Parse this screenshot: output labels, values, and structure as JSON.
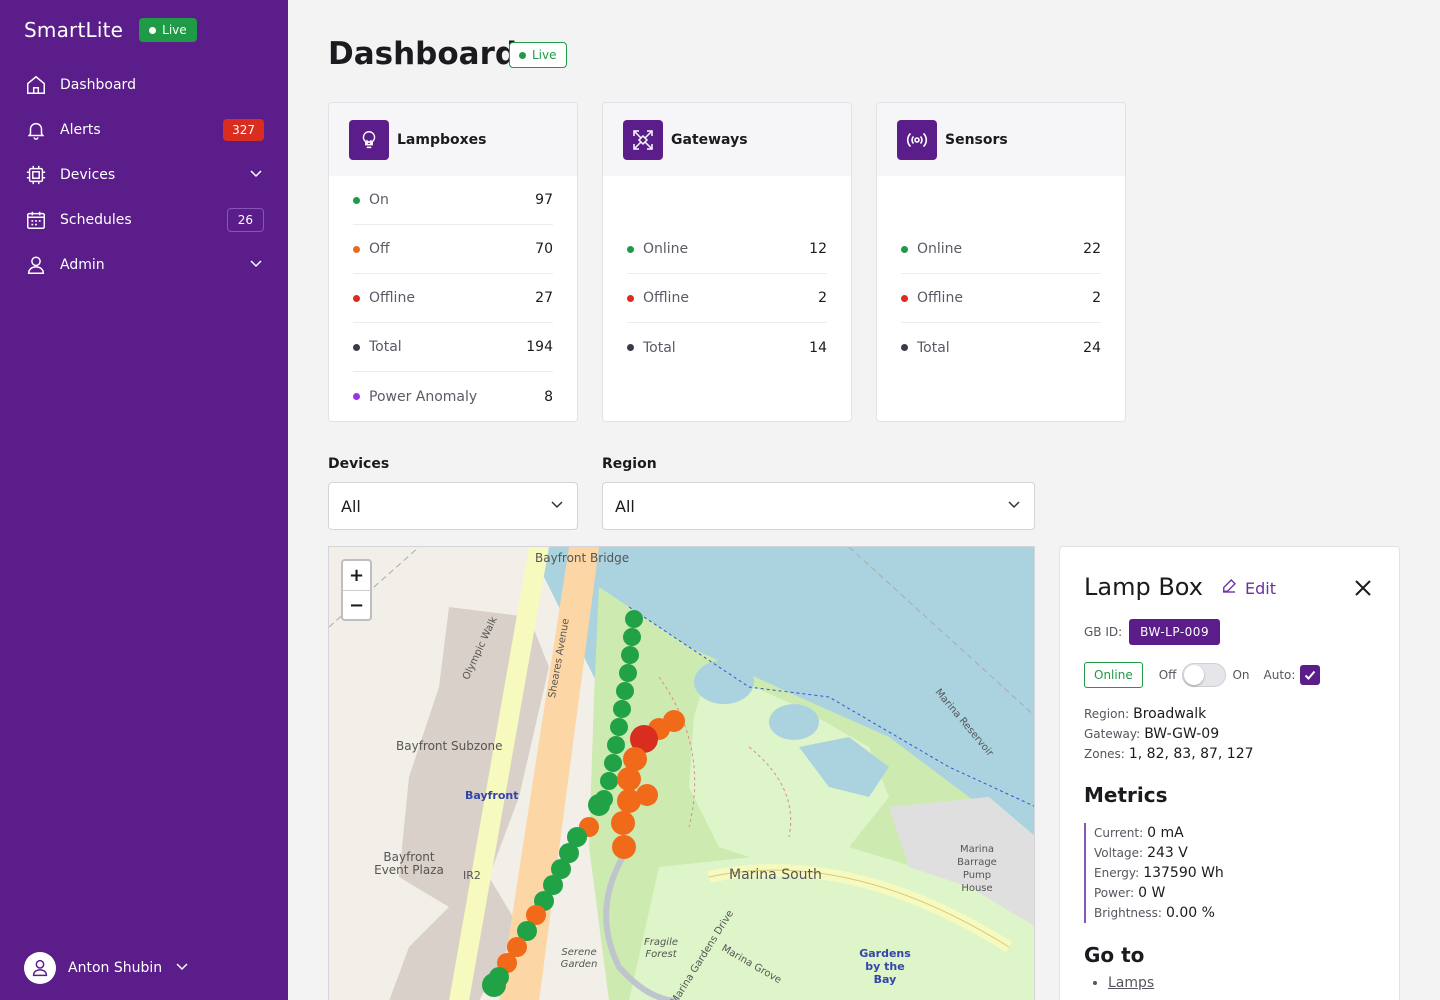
{
  "app": {
    "name": "SmartLite",
    "live_label": "Live"
  },
  "sidebar": {
    "items": [
      {
        "label": "Dashboard",
        "icon": "home-icon"
      },
      {
        "label": "Alerts",
        "icon": "bell-icon",
        "badge": "327"
      },
      {
        "label": "Devices",
        "icon": "chip-icon"
      },
      {
        "label": "Schedules",
        "icon": "calendar-icon",
        "badge": "26"
      },
      {
        "label": "Admin",
        "icon": "user-icon"
      }
    ],
    "user_name": "Anton Shubin"
  },
  "page": {
    "title": "Dashboard",
    "live_label": "Live"
  },
  "cards": {
    "lampboxes": {
      "title": "Lampboxes",
      "rows": [
        {
          "label": "On",
          "value": "97",
          "color": "#1f9a46"
        },
        {
          "label": "Off",
          "value": "70",
          "color": "#ea6a1c"
        },
        {
          "label": "Offline",
          "value": "27",
          "color": "#d92d20"
        },
        {
          "label": "Total",
          "value": "194",
          "color": "#3b3b48"
        },
        {
          "label": "Power Anomaly",
          "value": "8",
          "color": "#9a34e0"
        }
      ]
    },
    "gateways": {
      "title": "Gateways",
      "rows": [
        {
          "label": "Online",
          "value": "12",
          "color": "#1f9a46"
        },
        {
          "label": "Offline",
          "value": "2",
          "color": "#d92d20"
        },
        {
          "label": "Total",
          "value": "14",
          "color": "#3b3b48"
        }
      ]
    },
    "sensors": {
      "title": "Sensors",
      "rows": [
        {
          "label": "Online",
          "value": "22",
          "color": "#1f9a46"
        },
        {
          "label": "Offline",
          "value": "2",
          "color": "#d92d20"
        },
        {
          "label": "Total",
          "value": "24",
          "color": "#3b3b48"
        }
      ]
    }
  },
  "filters": {
    "devices": {
      "label": "Devices",
      "value": "All"
    },
    "region": {
      "label": "Region",
      "value": "All"
    }
  },
  "map": {
    "zoom_in": "+",
    "zoom_out": "−",
    "labels": {
      "bayfront_bridge": "Bayfront Bridge",
      "bayfront_subzone": "Bayfront Subzone",
      "bayfront": "Bayfront",
      "bayfront_event_plaza": "Bayfront Event Plaza",
      "ir2": "IR2",
      "marina_south": "Marina South",
      "sheares_avenue": "Sheares Avenue",
      "olympic_walk": "Olympic Walk",
      "marina_reservoir": "Marina Reservoir",
      "marina_barrage": "Marina Barrage Pump House",
      "gardens_by_the_bay": "Gardens by the Bay",
      "fragile_forest": "Fragile Forest",
      "serene_garden": "Serene Garden",
      "marina_gardens_drive": "Marina Gardens Drive",
      "marina_grove": "Marina Grove"
    }
  },
  "detail": {
    "title": "Lamp Box",
    "edit_label": "Edit",
    "gb_label": "GB ID:",
    "gb_id": "BW-LP-009",
    "status": "Online",
    "off_label": "Off",
    "on_label": "On",
    "auto_label": "Auto:",
    "region_label": "Region:",
    "region": "Broadwalk",
    "gateway_label": "Gateway:",
    "gateway": "BW-GW-09",
    "zones_label": "Zones:",
    "zones": "1, 82, 83, 87, 127",
    "metrics_title": "Metrics",
    "metrics": [
      {
        "label": "Current:",
        "value": "0 mA"
      },
      {
        "label": "Voltage:",
        "value": "243 V"
      },
      {
        "label": "Energy:",
        "value": "137590 Wh"
      },
      {
        "label": "Power:",
        "value": "0 W"
      },
      {
        "label": "Brightness:",
        "value": "0.00 %"
      }
    ],
    "goto_title": "Go to",
    "goto_links": [
      "Lamps"
    ]
  }
}
